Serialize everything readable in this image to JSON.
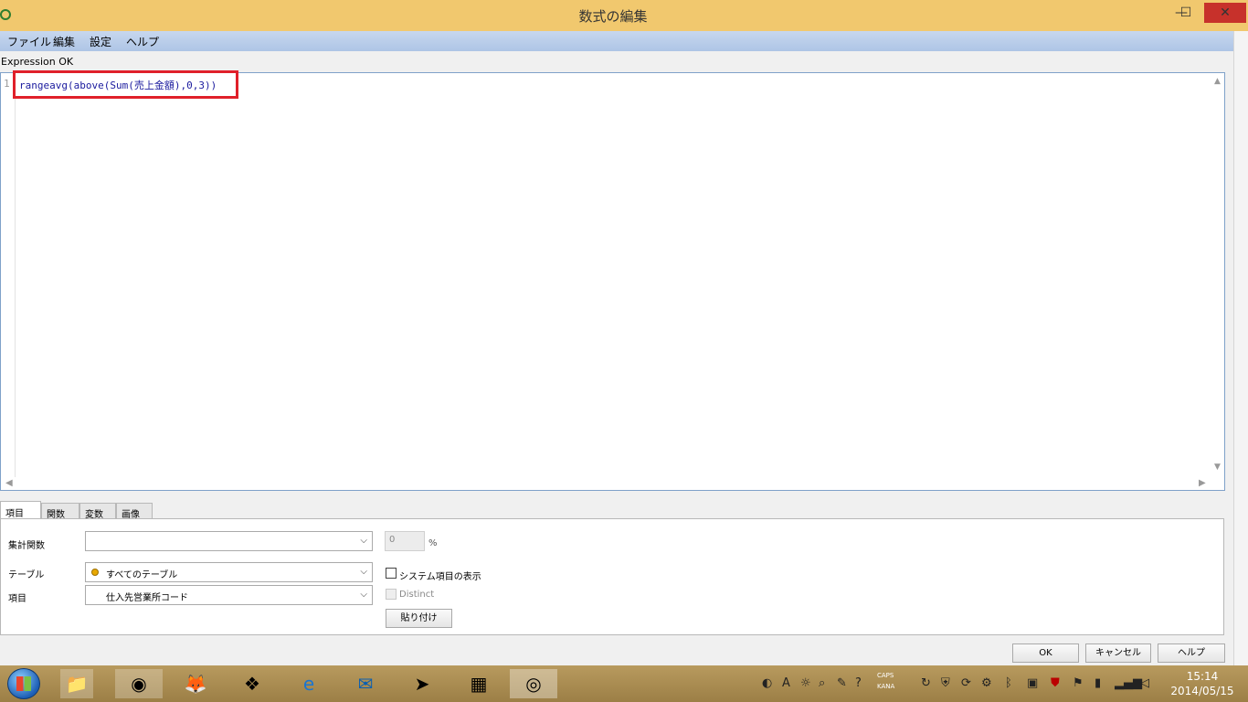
{
  "window": {
    "title": "数式の編集",
    "controls": {
      "minimize": "—",
      "maximize": "☐",
      "close": "✕"
    }
  },
  "menu": {
    "file": "ファイル",
    "edit": "編集",
    "settings": "設定",
    "help": "ヘルプ"
  },
  "status": "Expression OK",
  "editor": {
    "line_number": "1",
    "code": "rangeavg(above(Sum(売上金額),0,3))"
  },
  "tabs": [
    "項目",
    "関数",
    "変数",
    "画像"
  ],
  "panel": {
    "aggregate_label": "集計関数",
    "aggregate_value": "",
    "percent_value": "0",
    "percent_unit": "%",
    "table_label": "テーブル",
    "table_value": "すべてのテーブル",
    "field_label": "項目",
    "field_value": "仕入先営業所コード",
    "show_system_fields": "システム項目の表示",
    "distinct": "Distinct",
    "paste": "貼り付け"
  },
  "buttons": {
    "ok": "OK",
    "cancel": "キャンセル",
    "help": "ヘルプ"
  },
  "taskbar": {
    "tray": {
      "caps": "CAPS",
      "kana": "KANA"
    },
    "clock": {
      "time": "15:14",
      "date": "2014/05/15"
    }
  },
  "colors": {
    "titlebar": "#f1c86e",
    "menubar": "#b6cbea",
    "highlight_box": "#e0202a",
    "taskbar": "#a88a50"
  }
}
